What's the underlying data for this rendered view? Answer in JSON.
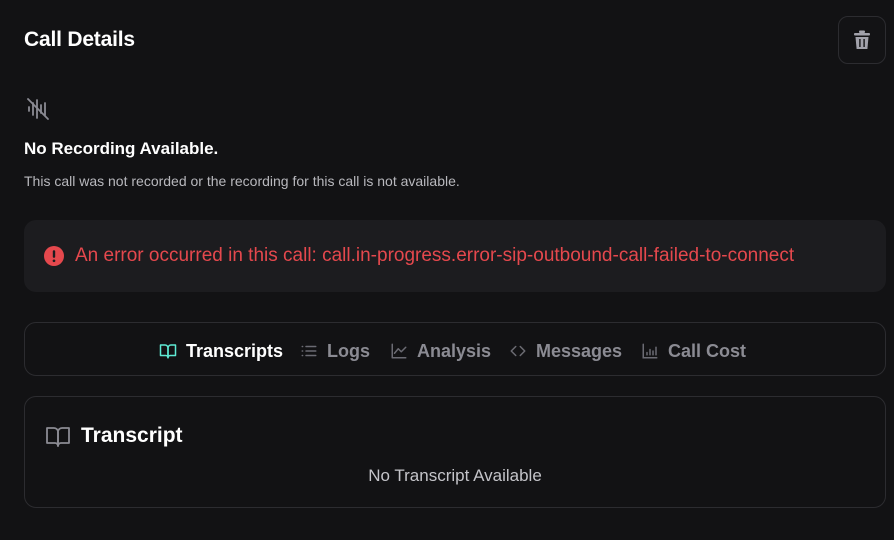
{
  "header": {
    "title": "Call Details",
    "delete_icon": "trash-icon"
  },
  "recording": {
    "icon": "audio-off-icon",
    "title": "No Recording Available.",
    "subtitle": "This call was not recorded or the recording for this call is not available."
  },
  "error": {
    "icon": "alert-circle-icon",
    "color": "#e5484d",
    "message": "An error occurred in this call: call.in-progress.error-sip-outbound-call-failed-to-connect"
  },
  "tabs": [
    {
      "label": "Transcripts",
      "icon": "book-open-icon",
      "active": true
    },
    {
      "label": "Logs",
      "icon": "list-icon",
      "active": false
    },
    {
      "label": "Analysis",
      "icon": "line-chart-icon",
      "active": false
    },
    {
      "label": "Messages",
      "icon": "code-icon",
      "active": false
    },
    {
      "label": "Call Cost",
      "icon": "chart-icon",
      "active": false
    }
  ],
  "transcript": {
    "icon": "book-open-icon",
    "title": "Transcript",
    "empty_text": "No Transcript Available"
  },
  "colors": {
    "background": "#121214",
    "accent": "#5eead4",
    "error": "#e5484d"
  }
}
